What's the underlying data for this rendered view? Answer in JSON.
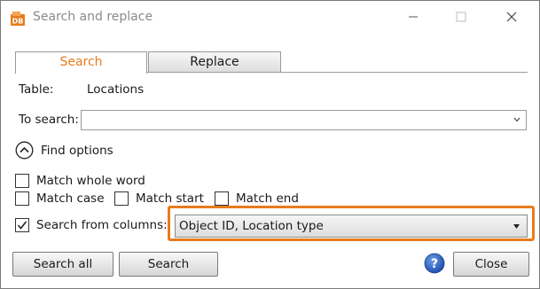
{
  "window": {
    "title": "Search and replace",
    "icons": {
      "app": "app-logo-icon",
      "minimize": "minimize-icon",
      "maximize": "maximize-icon",
      "close": "close-icon"
    }
  },
  "tabs": [
    {
      "label": "Search",
      "active": true
    },
    {
      "label": "Replace",
      "active": false
    }
  ],
  "table": {
    "label": "Table:",
    "value": "Locations"
  },
  "search": {
    "label": "To search:",
    "value": "",
    "placeholder": ""
  },
  "find_options": {
    "label": "Find options",
    "expanded": true
  },
  "options": {
    "match_whole_word": {
      "label": "Match whole word",
      "checked": false
    },
    "match_case": {
      "label": "Match case",
      "checked": false
    },
    "match_start": {
      "label": "Match start",
      "checked": false
    },
    "match_end": {
      "label": "Match end",
      "checked": false
    },
    "search_from_columns": {
      "label": "Search from columns:",
      "checked": true
    }
  },
  "columns_select": {
    "value": "Object ID, Location type"
  },
  "buttons": {
    "search_all": "Search all",
    "search": "Search",
    "close": "Close"
  },
  "colors": {
    "accent": "#e87b1e",
    "help_blue": "#2a64c4"
  }
}
